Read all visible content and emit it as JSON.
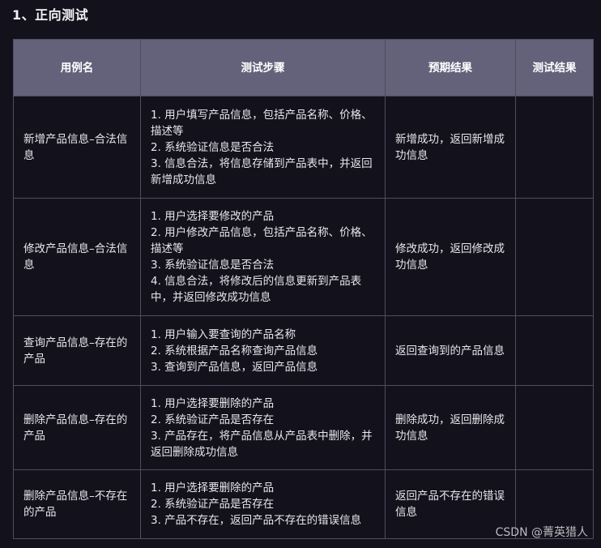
{
  "section_title": "1、正向测试",
  "table": {
    "headers": [
      "用例名",
      "测试步骤",
      "预期结果",
      "测试结果"
    ],
    "rows": [
      {
        "case_name": "新增产品信息–合法信息",
        "steps": [
          "1. 用户填写产品信息，包括产品名称、价格、描述等",
          "2. 系统验证信息是否合法",
          "3. 信息合法，将信息存储到产品表中，并返回新增成功信息"
        ],
        "expected": "新增成功，返回新增成功信息",
        "result": ""
      },
      {
        "case_name": "修改产品信息–合法信息",
        "steps": [
          "1. 用户选择要修改的产品",
          "2. 用户修改产品信息，包括产品名称、价格、描述等",
          "3. 系统验证信息是否合法",
          "4. 信息合法，将修改后的信息更新到产品表中，并返回修改成功信息"
        ],
        "expected": "修改成功，返回修改成功信息",
        "result": ""
      },
      {
        "case_name": "查询产品信息–存在的产品",
        "steps": [
          "1. 用户输入要查询的产品名称",
          "2. 系统根据产品名称查询产品信息",
          "3. 查询到产品信息，返回产品信息"
        ],
        "expected": "返回查询到的产品信息",
        "result": ""
      },
      {
        "case_name": "删除产品信息–存在的产品",
        "steps": [
          "1. 用户选择要删除的产品",
          "2. 系统验证产品是否存在",
          "3. 产品存在，将产品信息从产品表中删除，并返回删除成功信息"
        ],
        "expected": "删除成功，返回删除成功信息",
        "result": ""
      },
      {
        "case_name": "删除产品信息–不存在的产品",
        "steps": [
          "1. 用户选择要删除的产品",
          "2. 系统验证产品是否存在",
          "3. 产品不存在，返回产品不存在的错误信息"
        ],
        "expected": "返回产品不存在的错误信息",
        "result": ""
      }
    ]
  },
  "watermark": "CSDN @菁英猎人"
}
